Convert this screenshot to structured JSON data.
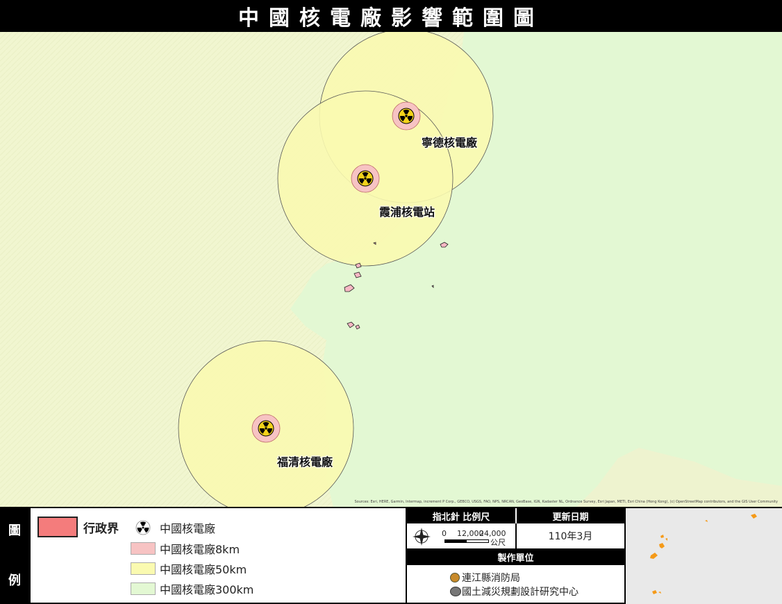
{
  "title": "中國核電廠影響範圍圖",
  "map": {
    "attribution": "Sources: Esri, HERE, Garmin, Intermap, increment P Corp., GEBCO, USGS, FAO, NPS, NRCAN, GeoBase, IGN, Kadaster NL, Ordnance Survey, Esri Japan, METI, Esri China (Hong Kong), (c) OpenStreetMap contributors, and the GIS User Community",
    "plants": [
      {
        "name": "寧德核電廠"
      },
      {
        "name": "霞浦核電站"
      },
      {
        "name": "福清核電廠"
      }
    ]
  },
  "legend": {
    "head_char_1": "圖",
    "head_char_2": "例",
    "items": [
      {
        "label": "行政界",
        "color": "#f47c7c",
        "icon": "admin-boundary-swatch"
      },
      {
        "label": "中國核電廠",
        "icon": "radiation-icon"
      },
      {
        "label": "中國核電廠8km",
        "color": "#f7c3c3"
      },
      {
        "label": "中國核電廠50km",
        "color": "#fafab0"
      },
      {
        "label": "中國核電廠300km",
        "color": "#e3f8d3"
      }
    ]
  },
  "info": {
    "compass_scale_header": "指北針 比例尺",
    "update_header": "更新日期",
    "update_value": "110年3月",
    "scale_labels": [
      "0",
      "12,000",
      "24,000"
    ],
    "scale_unit": "公尺",
    "producer_header": "製作單位",
    "producers": [
      "連江縣消防局",
      "國土減災規劃設計研究中心"
    ]
  },
  "colors": {
    "zone_300km": "#e3f8d3",
    "land": "#f1f6d0",
    "zone_50km": "#fafab0",
    "zone_8km": "#f7c3c3",
    "admin_boundary": "#f47c7c",
    "overview_islands": "#f59a18"
  }
}
